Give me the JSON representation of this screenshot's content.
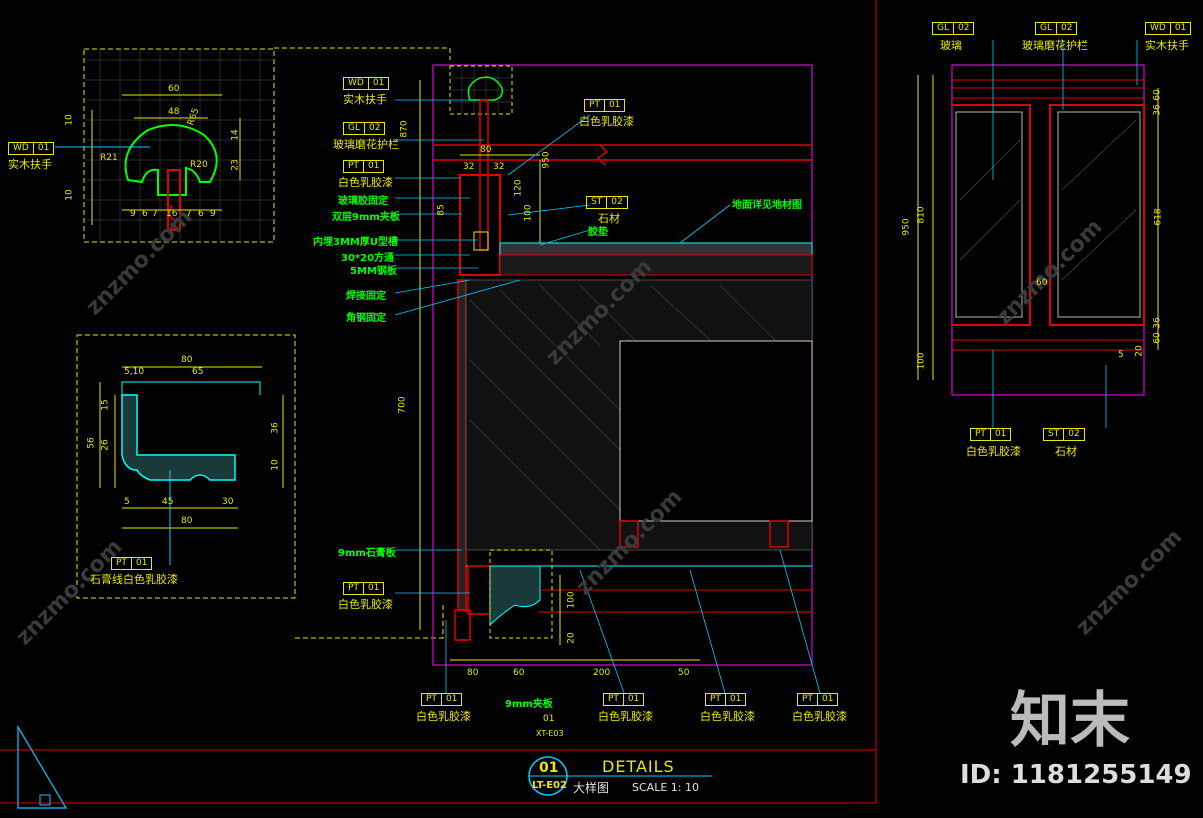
{
  "tags": {
    "wd01": {
      "code": "WD",
      "num": "01"
    },
    "gl02": {
      "code": "GL",
      "num": "02"
    },
    "pt01": {
      "code": "PT",
      "num": "01"
    },
    "st02": {
      "code": "ST",
      "num": "02"
    }
  },
  "captions": {
    "solid_wood_handrail": "实木扶手",
    "glass_frosted_guardrail": "玻璃磨花护栏",
    "white_latex_paint": "白色乳胶漆",
    "stone": "石材",
    "glass": "玻璃",
    "gypsum_line_white_paint": "石膏线白色乳胶漆"
  },
  "notes": {
    "glass_glue_fix": "玻璃胶固定",
    "double_9mm_plywood": "双层9mm夹板",
    "embedded_u_channel": "内埋3MM厚U型槽",
    "square_tube": "30*20方通",
    "steel_plate": "5MM钢板",
    "weld_fix": "焊接固定",
    "angle_steel_fix": "角钢固定",
    "gypsum_board_9mm": "9mm石膏板",
    "plywood_9mm": "9mm夹板",
    "glue_pad": "胶垫",
    "floor_material": "地面详见地材图"
  },
  "dims": {
    "d60": "60",
    "d48": "48",
    "d14": "14",
    "d23": "23",
    "r21": "R21",
    "r20": "R20",
    "r65": "R65",
    "d9": "9",
    "d6": "6",
    "d7": "7",
    "d16": "16",
    "d10": "10",
    "d80": "80",
    "d65": "65",
    "d510": "5,10",
    "d15": "15",
    "d5": "5",
    "d56": "56",
    "d26": "26",
    "d36": "36",
    "d45": "45",
    "d30": "30",
    "d870": "870",
    "d32": "32",
    "d85": "85",
    "d950": "950",
    "d100": "100",
    "d120": "120",
    "d700": "700",
    "d20": "20",
    "d200": "200",
    "d50": "50",
    "d810": "810",
    "d618": "618"
  },
  "title_block": {
    "number": "01",
    "sheet": "LT-E02",
    "title": "DETAILS",
    "name": "大样图",
    "scale": "SCALE   1: 10"
  },
  "section_label": {
    "number": "01",
    "sheet": "XT-E03"
  },
  "watermark": {
    "brand": "知末",
    "site": "znzmo.com",
    "id": "ID: 1181255149"
  }
}
